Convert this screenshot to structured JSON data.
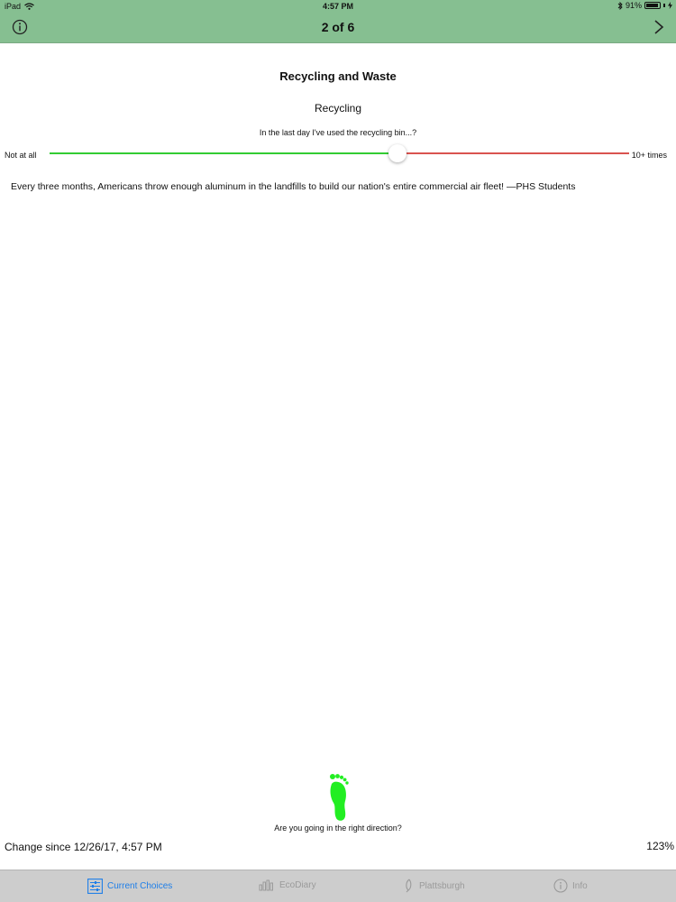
{
  "status_bar": {
    "device": "iPad",
    "time": "4:57 PM",
    "battery": "91%",
    "battery_level": 0.91,
    "icons": [
      "wifi-icon",
      "bluetooth-icon",
      "battery-icon",
      "charging-icon"
    ]
  },
  "nav": {
    "title": "2 of 6",
    "left_icon": "info-icon",
    "right_icon": "chevron-right-icon"
  },
  "section": {
    "title": "Recycling and Waste",
    "subtitle": "Recycling",
    "question": "In the last day I've used the recycling bin...?"
  },
  "slider": {
    "min_label": "Not at all",
    "max_label": "10+ times",
    "value_fraction": 0.6,
    "low_color": "#33cc33",
    "high_color": "#d9534f"
  },
  "fact": "Every three months, Americans throw enough aluminum in the landfills to build our nation's entire commercial air fleet! —PHS Students",
  "footer": {
    "icon": "footprint-icon",
    "icon_color": "#22ee22",
    "prompt": "Are you going in the right direction?",
    "change_label": "Change since 12/26/17, 4:57 PM",
    "percent": "123%"
  },
  "tabs": [
    {
      "label": "Current Choices",
      "icon": "sliders-icon",
      "active": true
    },
    {
      "label": "EcoDiary",
      "icon": "bar-chart-icon",
      "active": false
    },
    {
      "label": "Plattsburgh",
      "icon": "leaf-icon",
      "active": false
    },
    {
      "label": "Info",
      "icon": "info-icon",
      "active": false
    }
  ],
  "colors": {
    "header_green": "#86bf91",
    "tab_active": "#1e7ee8",
    "tab_inactive": "#9a9a9a"
  }
}
